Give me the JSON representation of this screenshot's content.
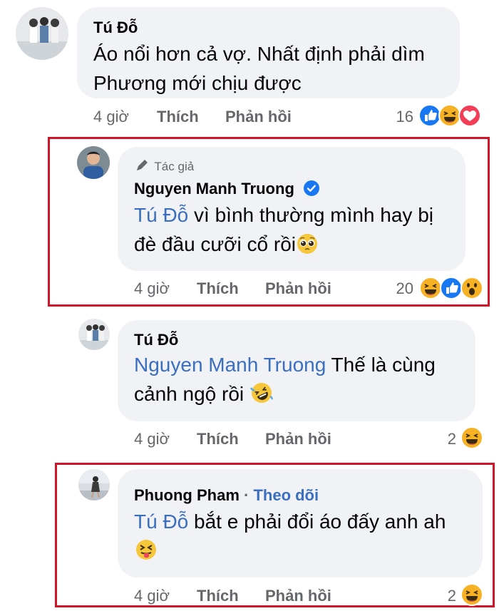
{
  "comments": [
    {
      "author": "Tú Đỗ",
      "text_lines": [
        "Áo nổi hơn cả vợ. Nhất định phải dìm",
        "Phương mới chịu được"
      ],
      "time": "4 giờ",
      "like": "Thích",
      "reply": "Phản hồi",
      "reaction_count": "16",
      "reactions": [
        "like-icon",
        "haha-icon",
        "love-icon"
      ]
    },
    {
      "author_badge": "Tác giả",
      "author": "Nguyen Manh Truong",
      "mention": "Tú Đỗ",
      "text_rest_line1": " vì bình thường mình hay bị",
      "text_line2": "đè đầu cưỡi cổ rồi",
      "emoji": "pleading-face-icon",
      "time": "4 giờ",
      "like": "Thích",
      "reply": "Phản hồi",
      "reaction_count": "20",
      "reactions": [
        "haha-icon",
        "like-icon",
        "wow-icon"
      ]
    },
    {
      "author": "Tú Đỗ",
      "mention": "Nguyen Manh Truong",
      "text_rest_line1": " Thế là cùng",
      "text_line2": "cảnh ngộ rồi ",
      "emoji": "rolling-laughing-icon",
      "time": "4 giờ",
      "like": "Thích",
      "reply": "Phản hồi",
      "reaction_count": "2",
      "reactions": [
        "haha-icon"
      ]
    },
    {
      "author": "Phuong Pham",
      "separator": " · ",
      "follow": "Theo dõi",
      "mention": "Tú Đỗ",
      "text_rest_line1": " bắt e phải đổi áo đấy anh ah",
      "emoji": "tongue-squint-icon",
      "time": "4 giờ",
      "like": "Thích",
      "reply": "Phản hồi",
      "reaction_count": "2",
      "reactions": [
        "haha-icon"
      ]
    }
  ],
  "colors": {
    "highlight_border": "#d0152b",
    "mention": "#3a6fbf",
    "bubble": "#f0f2f5",
    "like_blue": "#1877f2",
    "verified_blue": "#1877f2"
  }
}
